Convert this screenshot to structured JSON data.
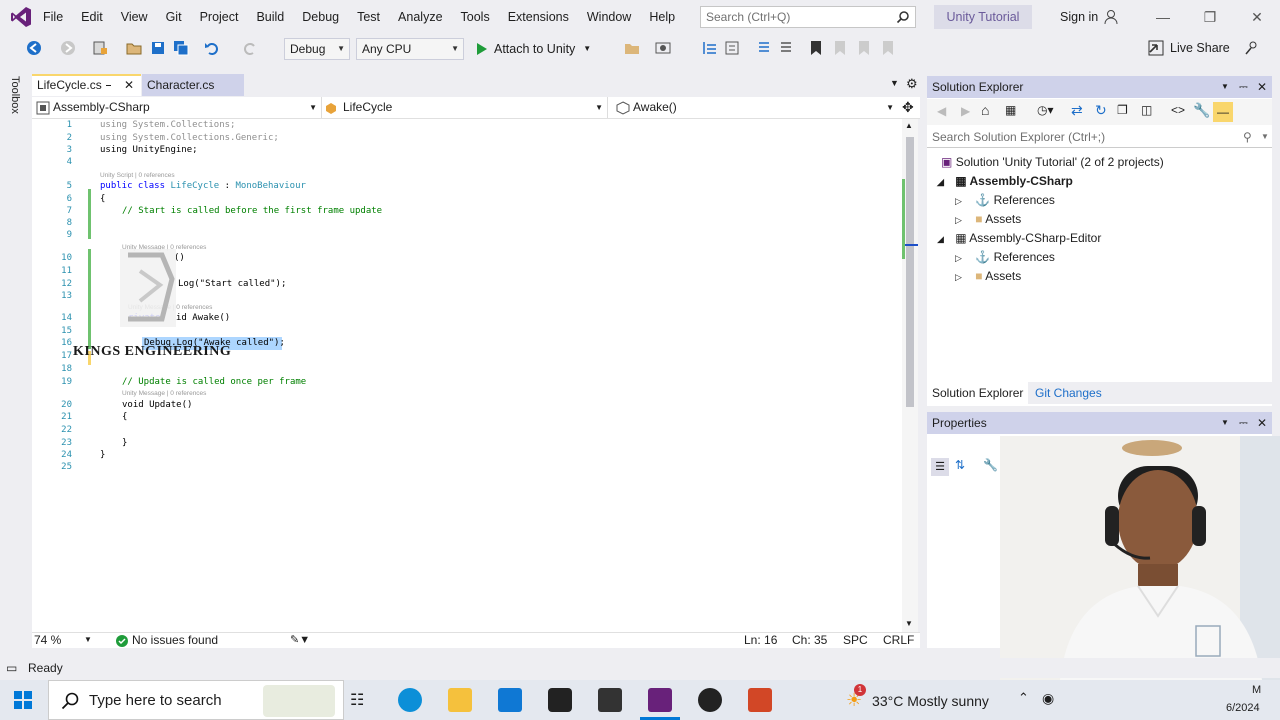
{
  "menubar": {
    "items": [
      "File",
      "Edit",
      "View",
      "Git",
      "Project",
      "Build",
      "Debug",
      "Test",
      "Analyze",
      "Tools",
      "Extensions",
      "Window",
      "Help"
    ],
    "search_placeholder": "Search (Ctrl+Q)",
    "solution_badge": "Unity Tutorial",
    "sign_in": "Sign in"
  },
  "toolbar": {
    "config": "Debug",
    "platform": "Any CPU",
    "attach": "Attach to Unity",
    "live_share": "Live Share"
  },
  "toolbox_label": "Toolbox",
  "tabs": [
    {
      "label": "LifeCycle.cs",
      "active": true
    },
    {
      "label": "Character.cs",
      "active": false
    }
  ],
  "navbar": {
    "project": "Assembly-CSharp",
    "class": "LifeCycle",
    "member": "Awake()"
  },
  "editor": {
    "lines": [
      "1",
      "2",
      "3",
      "4",
      "5",
      "6",
      "7",
      "8",
      "9",
      "10",
      "11",
      "12",
      "13",
      "14",
      "15",
      "16",
      "17",
      "18",
      "19",
      "20",
      "21",
      "22",
      "23",
      "24",
      "25"
    ],
    "code": {
      "l1": "using System.Collections;",
      "l2": "using System.Collections.Generic;",
      "l3": "using UnityEngine;",
      "lens_class": "Unity Script | 0 references",
      "l5_kw": "public class ",
      "l5_name": "LifeCycle",
      "l5_rest": " : ",
      "l5_base": "MonoBehaviour",
      "l6": "{",
      "l7": "// Start is called before the first frame update",
      "lens_start": "Unity Message | 0 references",
      "l10": "()",
      "l12": "Log(\"Start called\");",
      "lens_awake": "Unity Message | 0 references",
      "l14_a": "rivate",
      "l14_b": "id Awake()",
      "l16": "Debug.Log(\"Awake called\");",
      "l19": "// Update is called once per frame",
      "lens_update": "Unity Message | 0 references",
      "l20": "void Update()",
      "l21": "{",
      "l23": "}",
      "l24": "}"
    }
  },
  "editor_status": {
    "zoom": "74 %",
    "issues": "No issues found",
    "line": "Ln: 16",
    "col": "Ch: 35",
    "spc": "SPC",
    "eol": "CRLF"
  },
  "solution_explorer": {
    "title": "Solution Explorer",
    "search_placeholder": "Search Solution Explorer (Ctrl+;)",
    "solution": "Solution 'Unity Tutorial' (2 of 2 projects)",
    "project1": "Assembly-CSharp",
    "references": "References",
    "assets": "Assets",
    "project2": "Assembly-CSharp-Editor",
    "tab_se": "Solution Explorer",
    "tab_git": "Git Changes"
  },
  "properties": {
    "title": "Properties"
  },
  "status": {
    "ready": "Ready"
  },
  "taskbar": {
    "search_placeholder": "Type here to search",
    "weather": "33°C  Mostly sunny",
    "notification_count": "1",
    "clock_time": "M",
    "clock_date": "6/2024"
  },
  "watermark": "KINGS ENGINEERING",
  "colors": {
    "accent": "#68217a",
    "tab_active_border": "#f9d66c",
    "panel_title": "#cfd2ea"
  }
}
